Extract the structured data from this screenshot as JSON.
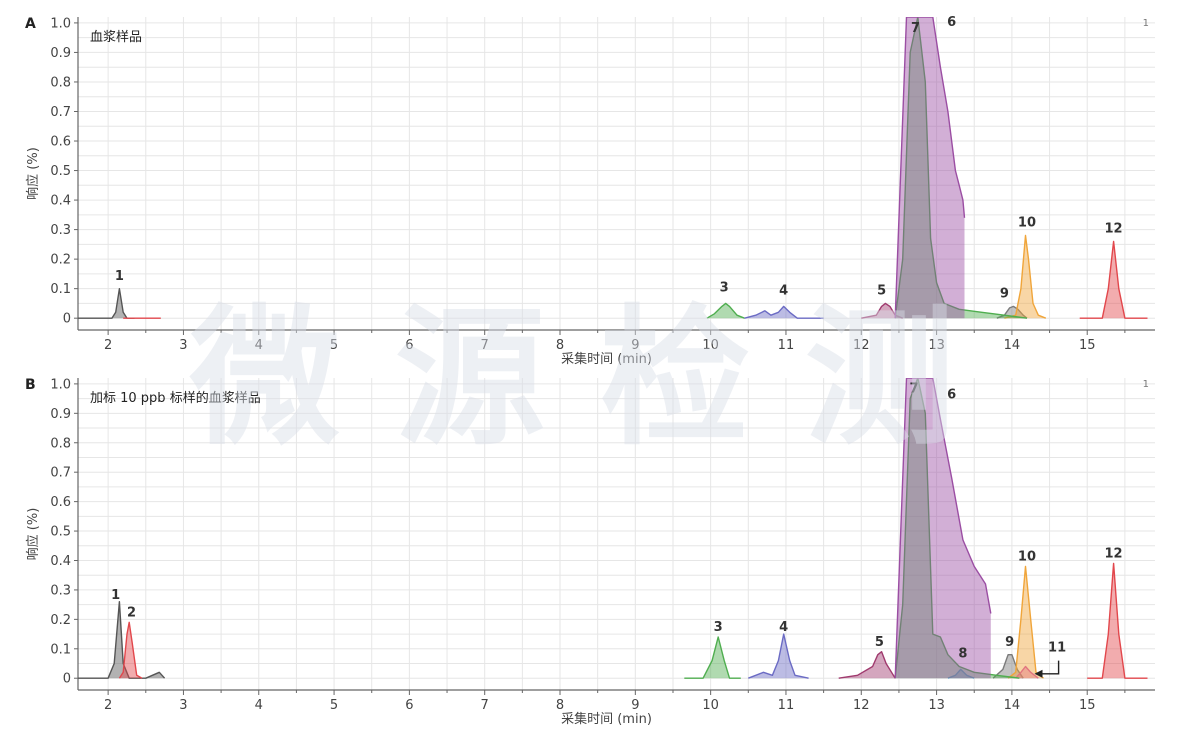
{
  "watermark": "微源检测",
  "chart_data": [
    {
      "type": "line",
      "panel": "A",
      "subtitle": "血浆样品",
      "xlabel": "采集时间 (min)",
      "ylabel": "响应 (%)",
      "corner_label": "1",
      "xlim": [
        1.6,
        15.9
      ],
      "ylim": [
        -0.04,
        1.02
      ],
      "x_ticks": [
        2,
        3,
        4,
        5,
        6,
        7,
        8,
        9,
        10,
        11,
        12,
        13,
        14,
        15
      ],
      "y_ticks": [
        0,
        0.1,
        0.2,
        0.3,
        0.4,
        0.5,
        0.6,
        0.7,
        0.8,
        0.9,
        1.0
      ],
      "y_tick_labels": [
        "0",
        "0.1",
        "0.2",
        "0.3",
        "0.4",
        "0.5",
        "0.6",
        "0.7",
        "0.8",
        "0.9",
        "1.0"
      ],
      "grid": true,
      "series": [
        {
          "color": "#555555",
          "x": [
            1.6,
            2.05,
            2.1,
            2.15,
            2.2,
            2.25,
            2.35
          ],
          "y": [
            0.0,
            0.0,
            0.02,
            0.1,
            0.02,
            0.0,
            0.0
          ]
        },
        {
          "color": "#e2474c",
          "x": [
            2.2,
            2.3,
            2.4,
            2.55,
            2.7
          ],
          "y": [
            0.0,
            0.0,
            0.0,
            0.0,
            0.0
          ]
        },
        {
          "color": "#4fae4f",
          "x": [
            9.95,
            10.05,
            10.15,
            10.2,
            10.25,
            10.35,
            10.45
          ],
          "y": [
            0.0,
            0.015,
            0.04,
            0.05,
            0.04,
            0.01,
            0.0
          ]
        },
        {
          "color": "#6b6bc4",
          "x": [
            10.45,
            10.6,
            10.72,
            10.8,
            10.9,
            10.97,
            11.05,
            11.15,
            11.5
          ],
          "y": [
            0.0,
            0.01,
            0.025,
            0.01,
            0.02,
            0.04,
            0.02,
            0.0,
            0.0
          ]
        },
        {
          "color": "#a03a6e",
          "x": [
            12.0,
            12.2,
            12.27,
            12.32,
            12.38,
            12.45,
            12.55
          ],
          "y": [
            0.0,
            0.01,
            0.04,
            0.05,
            0.04,
            0.01,
            0.0
          ]
        },
        {
          "color": "#7b7b7b",
          "x": [
            13.8,
            13.9,
            13.97,
            14.02,
            14.08,
            14.15,
            14.2
          ],
          "y": [
            0.0,
            0.01,
            0.035,
            0.04,
            0.03,
            0.01,
            0.0
          ]
        },
        {
          "color": "#f0a53a",
          "x": [
            13.9,
            14.05,
            14.12,
            14.18,
            14.22,
            14.28,
            14.35,
            14.45
          ],
          "y": [
            0.0,
            0.01,
            0.1,
            0.28,
            0.2,
            0.05,
            0.01,
            0.0
          ]
        },
        {
          "color": "#e2474c",
          "x": [
            14.9,
            15.2,
            15.28,
            15.35,
            15.42,
            15.5,
            15.8
          ],
          "y": [
            0.0,
            0.0,
            0.1,
            0.26,
            0.1,
            0.0,
            0.0
          ]
        },
        {
          "color": "#4fae4f",
          "x": [
            12.45,
            12.55,
            12.65,
            12.75,
            12.85,
            12.92,
            13.0,
            13.1,
            13.3,
            13.6,
            13.9,
            14.2
          ],
          "y": [
            0.0,
            0.2,
            0.9,
            1.02,
            0.8,
            0.27,
            0.12,
            0.05,
            0.03,
            0.02,
            0.01,
            0.0
          ]
        },
        {
          "color": "#9b4ea3",
          "x": [
            12.45,
            12.6,
            12.8,
            12.95,
            13.05,
            13.15,
            13.25,
            13.3,
            13.35,
            13.37
          ],
          "y": [
            0.0,
            1.02,
            1.02,
            1.02,
            0.85,
            0.7,
            0.5,
            0.45,
            0.4,
            0.34
          ]
        }
      ],
      "peak_labels": [
        {
          "text": "1",
          "x": 2.15,
          "y": 0.13
        },
        {
          "text": "3",
          "x": 10.18,
          "y": 0.09
        },
        {
          "text": "4",
          "x": 10.97,
          "y": 0.08
        },
        {
          "text": "5",
          "x": 12.27,
          "y": 0.08
        },
        {
          "text": "7",
          "x": 12.72,
          "y": 0.97
        },
        {
          "text": "6",
          "x": 13.2,
          "y": 0.99
        },
        {
          "text": "9",
          "x": 13.9,
          "y": 0.07
        },
        {
          "text": "10",
          "x": 14.2,
          "y": 0.31
        },
        {
          "text": "12",
          "x": 15.35,
          "y": 0.29
        }
      ]
    },
    {
      "type": "line",
      "panel": "B",
      "subtitle": "加标 10 ppb 标样的血浆样品",
      "xlabel": "采集时间 (min)",
      "ylabel": "响应 (%)",
      "corner_label": "1",
      "xlim": [
        1.6,
        15.9
      ],
      "ylim": [
        -0.04,
        1.02
      ],
      "x_ticks": [
        2,
        3,
        4,
        5,
        6,
        7,
        8,
        9,
        10,
        11,
        12,
        13,
        14,
        15
      ],
      "y_ticks": [
        0,
        0.1,
        0.2,
        0.3,
        0.4,
        0.5,
        0.6,
        0.7,
        0.8,
        0.9,
        1.0
      ],
      "y_tick_labels": [
        "0",
        "0.1",
        "0.2",
        "0.3",
        "0.4",
        "0.5",
        "0.6",
        "0.7",
        "0.8",
        "0.9",
        "1.0"
      ],
      "grid": true,
      "series": [
        {
          "color": "#555555",
          "x": [
            1.6,
            2.0,
            2.08,
            2.15,
            2.2,
            2.28,
            2.5,
            2.68,
            2.75
          ],
          "y": [
            0.0,
            0.0,
            0.05,
            0.26,
            0.05,
            0.0,
            0.0,
            0.02,
            0.0
          ]
        },
        {
          "color": "#e2474c",
          "x": [
            2.15,
            2.2,
            2.25,
            2.28,
            2.32,
            2.38,
            2.45
          ],
          "y": [
            0.0,
            0.02,
            0.15,
            0.19,
            0.12,
            0.01,
            0.0
          ]
        },
        {
          "color": "#4fae4f",
          "x": [
            9.65,
            9.9,
            10.02,
            10.1,
            10.18,
            10.25,
            10.4
          ],
          "y": [
            0.0,
            0.0,
            0.06,
            0.14,
            0.06,
            0.0,
            0.0
          ]
        },
        {
          "color": "#6b6bc4",
          "x": [
            10.5,
            10.7,
            10.82,
            10.9,
            10.97,
            11.05,
            11.12,
            11.3
          ],
          "y": [
            0.0,
            0.02,
            0.01,
            0.06,
            0.15,
            0.06,
            0.01,
            0.0
          ]
        },
        {
          "color": "#a03a6e",
          "x": [
            11.7,
            11.95,
            12.15,
            12.22,
            12.27,
            12.33,
            12.45
          ],
          "y": [
            0.0,
            0.01,
            0.04,
            0.08,
            0.09,
            0.05,
            0.0
          ]
        },
        {
          "color": "#5ab0e6",
          "x": [
            13.15,
            13.25,
            13.32,
            13.4,
            13.5
          ],
          "y": [
            0.0,
            0.01,
            0.03,
            0.01,
            0.0
          ]
        },
        {
          "color": "#7b7b7b",
          "x": [
            13.75,
            13.88,
            13.95,
            14.0,
            14.07,
            14.15
          ],
          "y": [
            0.0,
            0.03,
            0.08,
            0.08,
            0.03,
            0.0
          ]
        },
        {
          "color": "#d84fb8",
          "x": [
            14.05,
            14.12,
            14.18,
            14.25,
            14.35
          ],
          "y": [
            0.0,
            0.02,
            0.04,
            0.02,
            0.0
          ]
        },
        {
          "color": "#f0a53a",
          "x": [
            13.95,
            14.05,
            14.12,
            14.18,
            14.25,
            14.32,
            14.42
          ],
          "y": [
            0.0,
            0.02,
            0.2,
            0.38,
            0.2,
            0.02,
            0.0
          ]
        },
        {
          "color": "#e2474c",
          "x": [
            15.0,
            15.2,
            15.28,
            15.35,
            15.42,
            15.5,
            15.8
          ],
          "y": [
            0.0,
            0.0,
            0.15,
            0.39,
            0.15,
            0.0,
            0.0
          ]
        },
        {
          "color": "#4fae4f",
          "x": [
            12.45,
            12.55,
            12.65,
            12.75,
            12.85,
            12.95,
            13.05,
            13.15,
            13.3,
            13.5,
            13.8,
            14.1
          ],
          "y": [
            0.0,
            0.25,
            0.95,
            1.02,
            0.9,
            0.15,
            0.14,
            0.08,
            0.04,
            0.02,
            0.01,
            0.0
          ]
        },
        {
          "color": "#9b4ea3",
          "x": [
            12.45,
            12.6,
            12.8,
            12.95,
            13.05,
            13.2,
            13.35,
            13.5,
            13.65,
            13.72
          ],
          "y": [
            0.0,
            1.02,
            1.02,
            1.02,
            0.88,
            0.68,
            0.47,
            0.38,
            0.32,
            0.22
          ]
        }
      ],
      "peak_labels": [
        {
          "text": "1",
          "x": 2.1,
          "y": 0.27
        },
        {
          "text": "2",
          "x": 2.31,
          "y": 0.21
        },
        {
          "text": "3",
          "x": 10.1,
          "y": 0.16
        },
        {
          "text": "4",
          "x": 10.97,
          "y": 0.16
        },
        {
          "text": "5",
          "x": 12.24,
          "y": 0.11
        },
        {
          "text": "7",
          "x": 12.7,
          "y": 0.97
        },
        {
          "text": "6",
          "x": 13.2,
          "y": 0.95
        },
        {
          "text": "8",
          "x": 13.35,
          "y": 0.07
        },
        {
          "text": "9",
          "x": 13.97,
          "y": 0.11
        },
        {
          "text": "10",
          "x": 14.2,
          "y": 0.4
        },
        {
          "text": "11",
          "x": 14.6,
          "y": 0.09
        },
        {
          "text": "12",
          "x": 15.35,
          "y": 0.41
        }
      ],
      "arrow": {
        "from": [
          14.62,
          0.06
        ],
        "to": [
          14.3,
          0.015
        ]
      }
    }
  ]
}
